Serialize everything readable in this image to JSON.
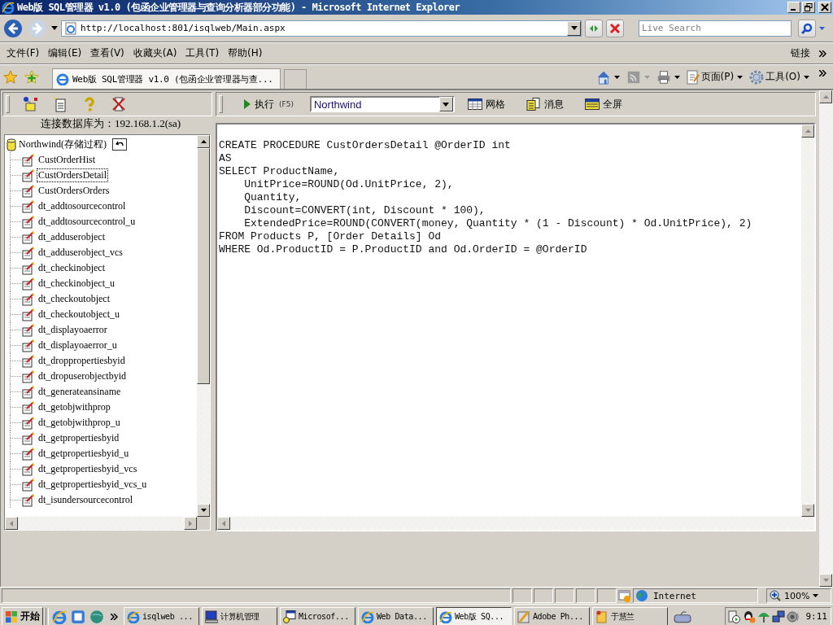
{
  "window": {
    "title": "Web版 SQL管理器 v1.0 (包函企业管理器与查询分析器部分功能) - Microsoft Internet Explorer"
  },
  "address_bar": {
    "url": "http://localhost:801/isqlweb/Main.aspx"
  },
  "search": {
    "placeholder": "Live Search"
  },
  "menu": [
    "文件(F)",
    "编辑(E)",
    "查看(V)",
    "收藏夹(A)",
    "工具(T)",
    "帮助(H)"
  ],
  "links_label": "链接",
  "tabs": [
    {
      "title": "Web版 SQL管理器 v1.0 (包函企业管理器与查...",
      "selected": true
    }
  ],
  "command_bar": {
    "page": "页面(P)",
    "tools": "工具(O)"
  },
  "left_panel": {
    "connection": "连接数据库为：192.168.1.2(sa)",
    "tree": {
      "label": "Northwind(存储过程)",
      "children": [
        {
          "label": "CustOrderHist",
          "selected": false
        },
        {
          "label": "CustOrdersDetail",
          "selected": true
        },
        {
          "label": "CustOrdersOrders",
          "selected": false
        },
        {
          "label": "dt_addtosourcecontrol",
          "selected": false
        },
        {
          "label": "dt_addtosourcecontrol_u",
          "selected": false
        },
        {
          "label": "dt_adduserobject",
          "selected": false
        },
        {
          "label": "dt_adduserobject_vcs",
          "selected": false
        },
        {
          "label": "dt_checkinobject",
          "selected": false
        },
        {
          "label": "dt_checkinobject_u",
          "selected": false
        },
        {
          "label": "dt_checkoutobject",
          "selected": false
        },
        {
          "label": "dt_checkoutobject_u",
          "selected": false
        },
        {
          "label": "dt_displayoaerror",
          "selected": false
        },
        {
          "label": "dt_displayoaerror_u",
          "selected": false
        },
        {
          "label": "dt_droppropertiesbyid",
          "selected": false
        },
        {
          "label": "dt_dropuserobjectbyid",
          "selected": false
        },
        {
          "label": "dt_generateansiname",
          "selected": false
        },
        {
          "label": "dt_getobjwithprop",
          "selected": false
        },
        {
          "label": "dt_getobjwithprop_u",
          "selected": false
        },
        {
          "label": "dt_getpropertiesbyid",
          "selected": false
        },
        {
          "label": "dt_getpropertiesbyid_u",
          "selected": false
        },
        {
          "label": "dt_getpropertiesbyid_vcs",
          "selected": false
        },
        {
          "label": "dt_getpropertiesbyid_vcs_u",
          "selected": false
        },
        {
          "label": "dt_isundersourcecontrol",
          "selected": false
        }
      ]
    }
  },
  "query_toolbar": {
    "execute": "执行",
    "shortcut": "(F5)",
    "database": "Northwind",
    "buttons": [
      {
        "label": "网格",
        "kind": "grid"
      },
      {
        "label": "消息",
        "kind": "messages"
      },
      {
        "label": "全屏",
        "kind": "fullscreen"
      }
    ]
  },
  "editor": {
    "lines": [
      "CREATE PROCEDURE CustOrdersDetail @OrderID int",
      "AS",
      "SELECT ProductName,",
      "    UnitPrice=ROUND(Od.UnitPrice, 2),",
      "    Quantity,",
      "    Discount=CONVERT(int, Discount * 100),",
      "    ExtendedPrice=ROUND(CONVERT(money, Quantity * (1 - Discount) * Od.UnitPrice), 2)",
      "FROM Products P, [Order Details] Od",
      "WHERE Od.ProductID = P.ProductID and Od.OrderID = @OrderID"
    ]
  },
  "status_bar": {
    "zone": "Internet",
    "zoom": "100%"
  },
  "taskbar": {
    "start": "开始",
    "items": [
      {
        "label": "isqlweb ...",
        "kind": "browser",
        "selected": false
      },
      {
        "label": "计算机管理",
        "kind": "computer",
        "selected": false
      },
      {
        "label": "Microsof...",
        "kind": "console",
        "selected": false
      },
      {
        "label": "Web Data...",
        "kind": "browser",
        "selected": false
      },
      {
        "label": "Web版 SQ...",
        "kind": "browser",
        "selected": true
      },
      {
        "label": "Adobe Ph...",
        "kind": "brush",
        "selected": false
      },
      {
        "label": "于慧兰",
        "kind": "note",
        "selected": false
      }
    ],
    "clock": "9:11"
  }
}
